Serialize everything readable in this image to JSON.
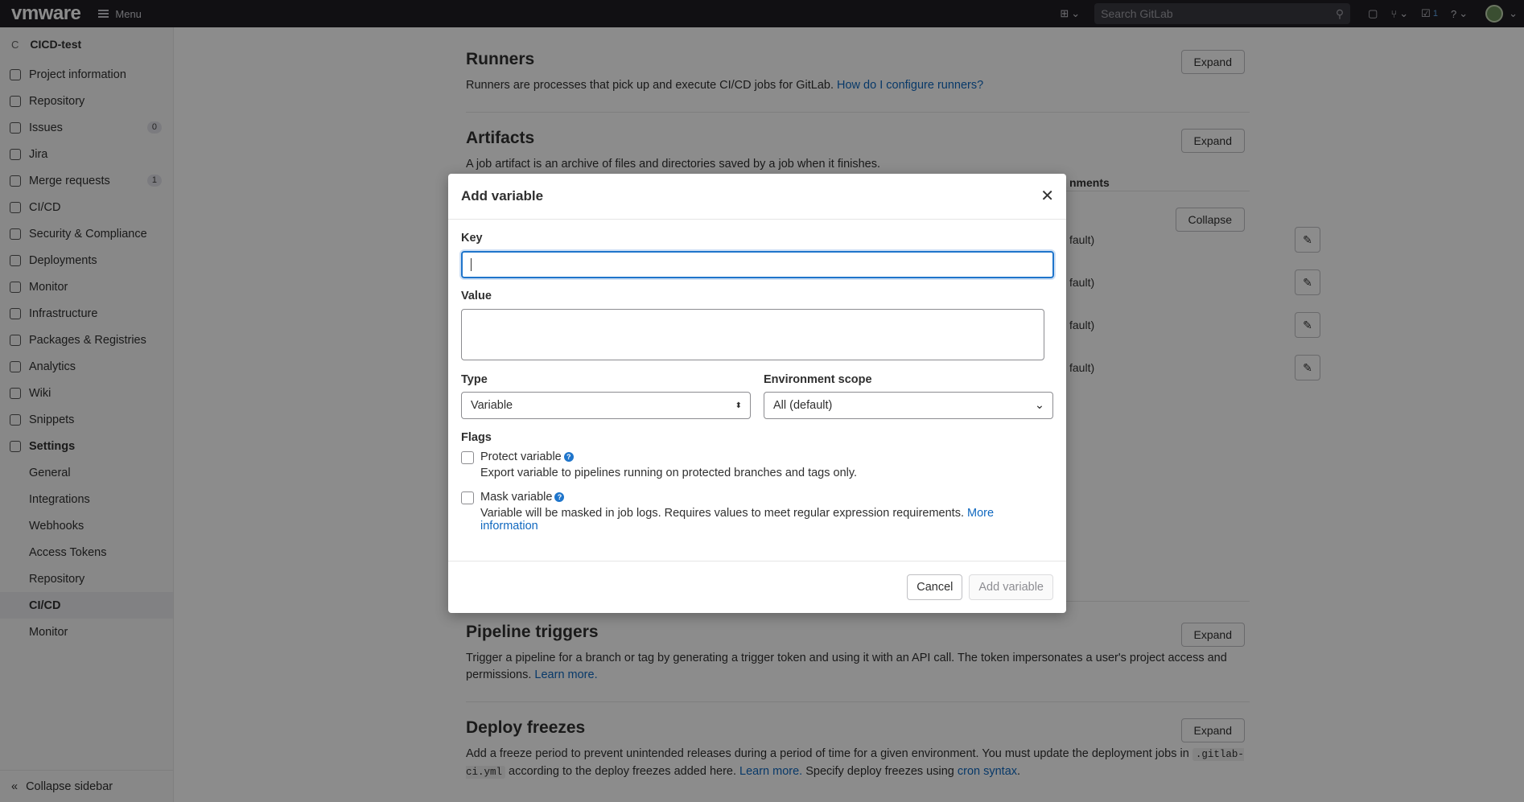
{
  "topbar": {
    "logo": "vmware",
    "menu_label": "Menu",
    "search_placeholder": "Search GitLab",
    "todo_count": "1"
  },
  "sidebar": {
    "project_initial": "C",
    "project_name": "CICD-test",
    "items": [
      {
        "label": "Project information",
        "icon": "info-icon"
      },
      {
        "label": "Repository",
        "icon": "book-icon"
      },
      {
        "label": "Issues",
        "icon": "issues-icon",
        "badge": "0"
      },
      {
        "label": "Jira",
        "icon": "external-icon"
      },
      {
        "label": "Merge requests",
        "icon": "merge-request-icon",
        "badge": "1"
      },
      {
        "label": "CI/CD",
        "icon": "rocket-icon"
      },
      {
        "label": "Security & Compliance",
        "icon": "shield-icon"
      },
      {
        "label": "Deployments",
        "icon": "deployments-icon"
      },
      {
        "label": "Monitor",
        "icon": "monitor-icon"
      },
      {
        "label": "Infrastructure",
        "icon": "cloud-icon"
      },
      {
        "label": "Packages & Registries",
        "icon": "package-icon"
      },
      {
        "label": "Analytics",
        "icon": "chart-icon"
      },
      {
        "label": "Wiki",
        "icon": "wiki-icon"
      },
      {
        "label": "Snippets",
        "icon": "snippet-icon"
      },
      {
        "label": "Settings",
        "icon": "gear-icon"
      }
    ],
    "settings_sub": [
      "General",
      "Integrations",
      "Webhooks",
      "Access Tokens",
      "Repository",
      "CI/CD",
      "Monitor"
    ],
    "collapse_label": "Collapse sidebar"
  },
  "sections": {
    "runners": {
      "title": "Runners",
      "desc": "Runners are processes that pick up and execute CI/CD jobs for GitLab.",
      "link": "How do I configure runners?",
      "button": "Expand"
    },
    "artifacts": {
      "title": "Artifacts",
      "desc": "A job artifact is an archive of files and directories saved by a job when it finishes.",
      "button": "Expand"
    },
    "variables": {
      "button": "Collapse",
      "col_header_partial": "nments",
      "row_scope_partial": "fault)"
    },
    "triggers": {
      "title": "Pipeline triggers",
      "desc": "Trigger a pipeline for a branch or tag by generating a trigger token and using it with an API call. The token impersonates a user's project access and permissions.",
      "link": "Learn more.",
      "button": "Expand"
    },
    "freezes": {
      "title": "Deploy freezes",
      "desc1": "Add a freeze period to prevent unintended releases during a period of time for a given environment. You must update the deployment jobs in",
      "code": ".gitlab-ci.yml",
      "desc2": "according to the deploy freezes added here.",
      "link1": "Learn more.",
      "desc3": "Specify deploy freezes using",
      "link2": "cron syntax",
      "button": "Expand"
    }
  },
  "modal": {
    "title": "Add variable",
    "key_label": "Key",
    "key_value": "",
    "value_label": "Value",
    "type_label": "Type",
    "type_value": "Variable",
    "env_label": "Environment scope",
    "env_value": "All (default)",
    "flags_label": "Flags",
    "protect_label": "Protect variable",
    "protect_desc": "Export variable to pipelines running on protected branches and tags only.",
    "protect_checked": false,
    "mask_label": "Mask variable",
    "mask_desc": "Variable will be masked in job logs. Requires values to meet regular expression requirements.",
    "mask_link": "More information",
    "mask_checked": false,
    "cancel_label": "Cancel",
    "submit_label": "Add variable"
  }
}
